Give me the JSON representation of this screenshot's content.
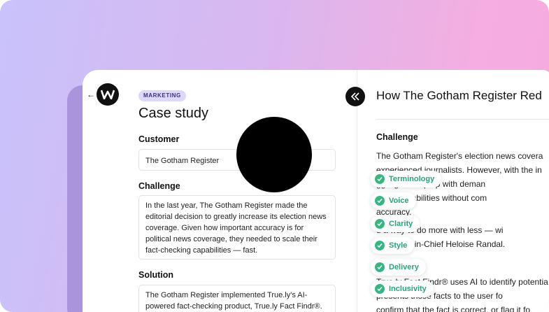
{
  "left": {
    "badge": "MARKETING",
    "title": "Case study",
    "customer_label": "Customer",
    "customer_value": "The Gotham Register",
    "challenge_label": "Challenge",
    "challenge_lines": [
      "In the last year, The Gotham Register made the",
      "editorial decision to greatly increase its election news",
      "coverage. Given how important accuracy is for",
      "political news coverage, they needed to scale their",
      "fact-checking capabilities — fast."
    ],
    "solution_label": "Solution",
    "solution_lines": [
      "The Gotham Register implemented True.ly's AI-",
      "powered fact-checking product, True.ly Fact Findr®."
    ]
  },
  "right": {
    "title": "How The Gotham Register Red",
    "heading": "Challenge",
    "lines": [
      "The Gotham Register's election news covera",
      "experienced journalists. However, with the in",
      "                        ggling to keep up with deman",
      "                        cking capabilities without com",
      "accuracy.",
      "                        d a way to do more with less — wi",
      "                        aid Editor-in-Chief Heloise Randal.",
      "True.ly Fact Findr® uses AI to identify potentia",
      "                        presents those facts to the user fo",
      "confirm that the fact is correct, or flag it fo"
    ]
  },
  "tags": [
    "Terminology",
    "Voice",
    "Clarity",
    "Style",
    "Delivery",
    "Inclusivity"
  ],
  "colors": {
    "accent_green": "#39b584",
    "badge_bg": "#ddd7fb"
  }
}
